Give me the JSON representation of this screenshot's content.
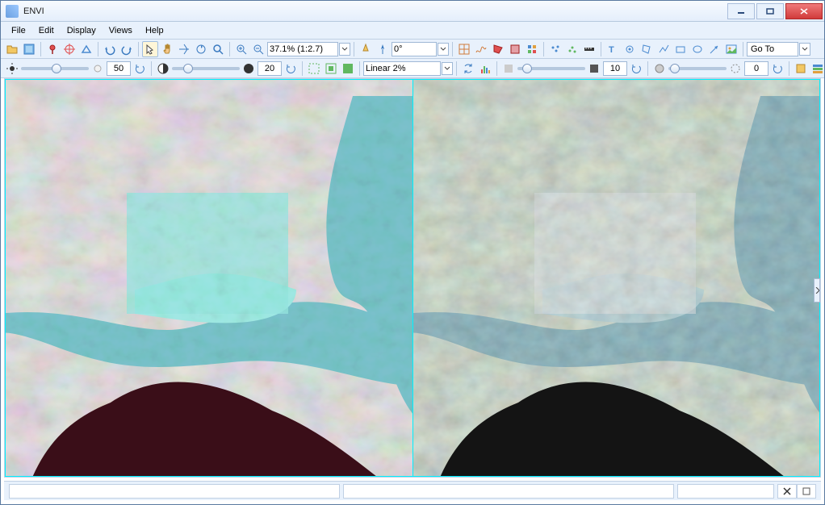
{
  "window": {
    "title": "ENVI"
  },
  "menu": {
    "items": [
      "File",
      "Edit",
      "Display",
      "Views",
      "Help"
    ]
  },
  "toolbar1": {
    "zoom": "37.1% (1:2.7)",
    "rotation": "0°",
    "goto_label": "Go To"
  },
  "toolbar2": {
    "slider1_value": "50",
    "slider2_value": "20",
    "stretch": "Linear 2%",
    "slider3_value": "10",
    "slider4_value": "0"
  }
}
